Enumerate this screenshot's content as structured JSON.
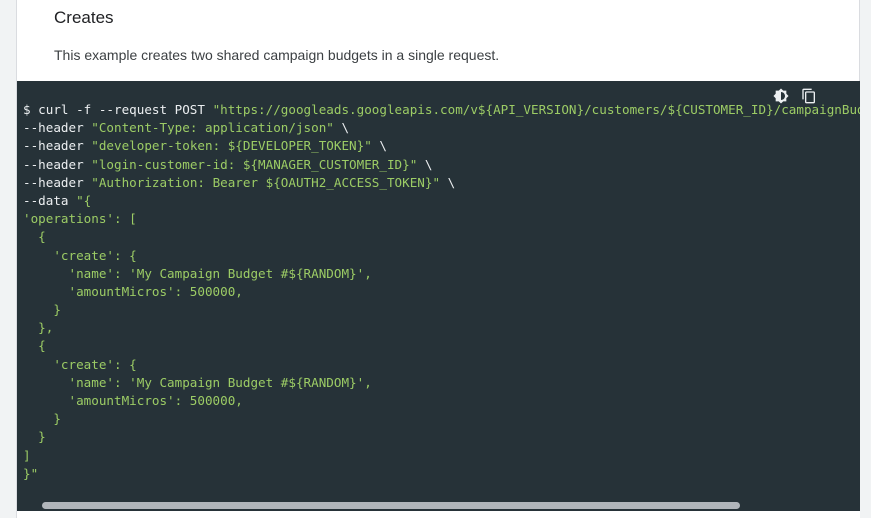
{
  "section": {
    "heading": "Creates",
    "description": "This example creates two shared campaign budgets in a single request."
  },
  "toolbar": {
    "icons": [
      "dark-mode-toggle-icon",
      "copy-icon"
    ]
  },
  "code": {
    "lines": [
      [
        {
          "t": "plain",
          "v": "$ curl -f --request POST "
        },
        {
          "t": "str",
          "v": "\"https://googleads.googleapis.com/v${API_VERSION}/customers/${CUSTOMER_ID}/campaignBud"
        }
      ],
      [
        {
          "t": "plain",
          "v": "--header "
        },
        {
          "t": "str",
          "v": "\"Content-Type: application/json\""
        },
        {
          "t": "plain",
          "v": " \\"
        }
      ],
      [
        {
          "t": "plain",
          "v": "--header "
        },
        {
          "t": "str",
          "v": "\"developer-token: ${DEVELOPER_TOKEN}\""
        },
        {
          "t": "plain",
          "v": " \\"
        }
      ],
      [
        {
          "t": "plain",
          "v": "--header "
        },
        {
          "t": "str",
          "v": "\"login-customer-id: ${MANAGER_CUSTOMER_ID}\""
        },
        {
          "t": "plain",
          "v": " \\"
        }
      ],
      [
        {
          "t": "plain",
          "v": "--header "
        },
        {
          "t": "str",
          "v": "\"Authorization: Bearer ${OAUTH2_ACCESS_TOKEN}\""
        },
        {
          "t": "plain",
          "v": " \\"
        }
      ],
      [
        {
          "t": "plain",
          "v": "--data "
        },
        {
          "t": "str",
          "v": "\"{"
        }
      ],
      [
        {
          "t": "str",
          "v": "'operations': ["
        }
      ],
      [
        {
          "t": "str",
          "v": "  {"
        }
      ],
      [
        {
          "t": "str",
          "v": "    'create': {"
        }
      ],
      [
        {
          "t": "str",
          "v": "      'name': 'My Campaign Budget #${RANDOM}',"
        }
      ],
      [
        {
          "t": "str",
          "v": "      'amountMicros': 500000,"
        }
      ],
      [
        {
          "t": "str",
          "v": "    }"
        }
      ],
      [
        {
          "t": "str",
          "v": "  },"
        }
      ],
      [
        {
          "t": "str",
          "v": "  {"
        }
      ],
      [
        {
          "t": "str",
          "v": "    'create': {"
        }
      ],
      [
        {
          "t": "str",
          "v": "      'name': 'My Campaign Budget #${RANDOM}',"
        }
      ],
      [
        {
          "t": "str",
          "v": "      'amountMicros': 500000,"
        }
      ],
      [
        {
          "t": "str",
          "v": "    }"
        }
      ],
      [
        {
          "t": "str",
          "v": "  }"
        }
      ],
      [
        {
          "t": "str",
          "v": "]"
        }
      ],
      [
        {
          "t": "str",
          "v": "}\""
        }
      ]
    ]
  },
  "colors": {
    "code_background": "#263238",
    "code_text": "#eceff1",
    "string": "#9ccc65",
    "scrollbar_thumb": "#b0b5ba"
  }
}
